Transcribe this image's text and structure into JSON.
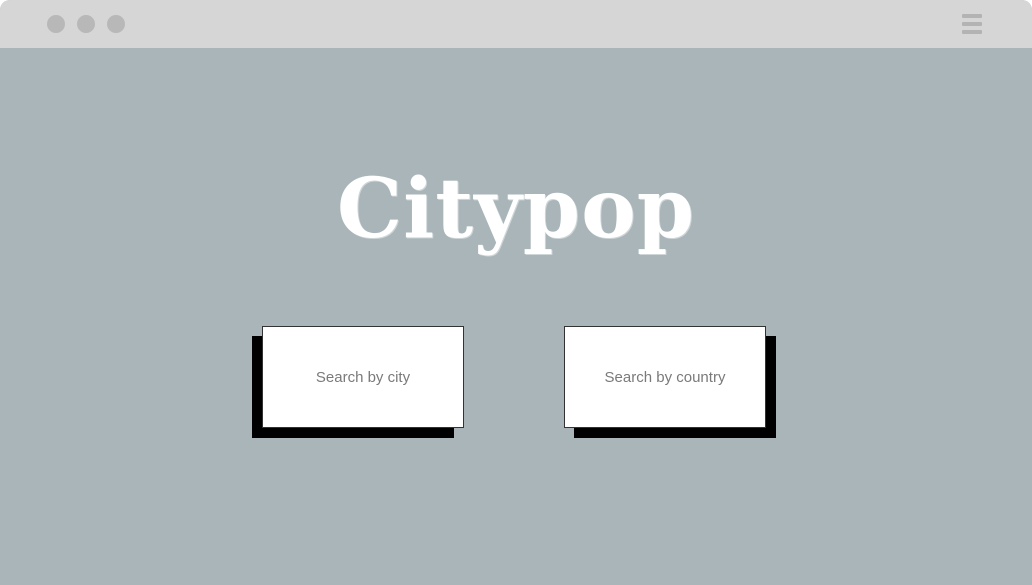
{
  "window": {
    "controls": [
      "window-dot",
      "window-dot",
      "window-dot"
    ],
    "menu_icon": "hamburger-menu-icon"
  },
  "header": {
    "logo_text": "Citypop"
  },
  "search_options": [
    {
      "label": "Search by city"
    },
    {
      "label": "Search by country"
    }
  ],
  "colors": {
    "background": "#a9b5b9",
    "titlebar": "#d6d6d6",
    "card": "#ffffff",
    "card_shadow": "#000000",
    "logo": "#ffffff"
  }
}
